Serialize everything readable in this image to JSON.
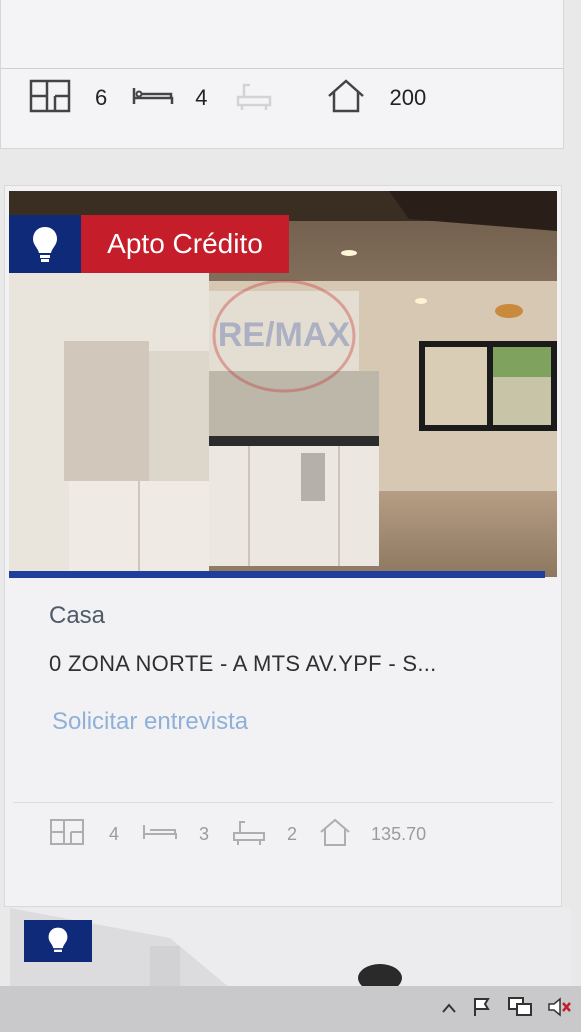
{
  "prev_card": {
    "specs": {
      "rooms": "6",
      "beds": "4",
      "area": "200"
    }
  },
  "card": {
    "badge": "Apto Crédito",
    "type": "Casa",
    "address": "0 ZONA NORTE - A MTS AV.YPF - S...",
    "link": "Solicitar entrevista",
    "specs": {
      "rooms": "4",
      "beds": "3",
      "baths": "2",
      "area": "135.70"
    }
  },
  "colors": {
    "badge_blue": "#0e2a78",
    "badge_red": "#c51d2a",
    "link": "#8fb0d8"
  }
}
